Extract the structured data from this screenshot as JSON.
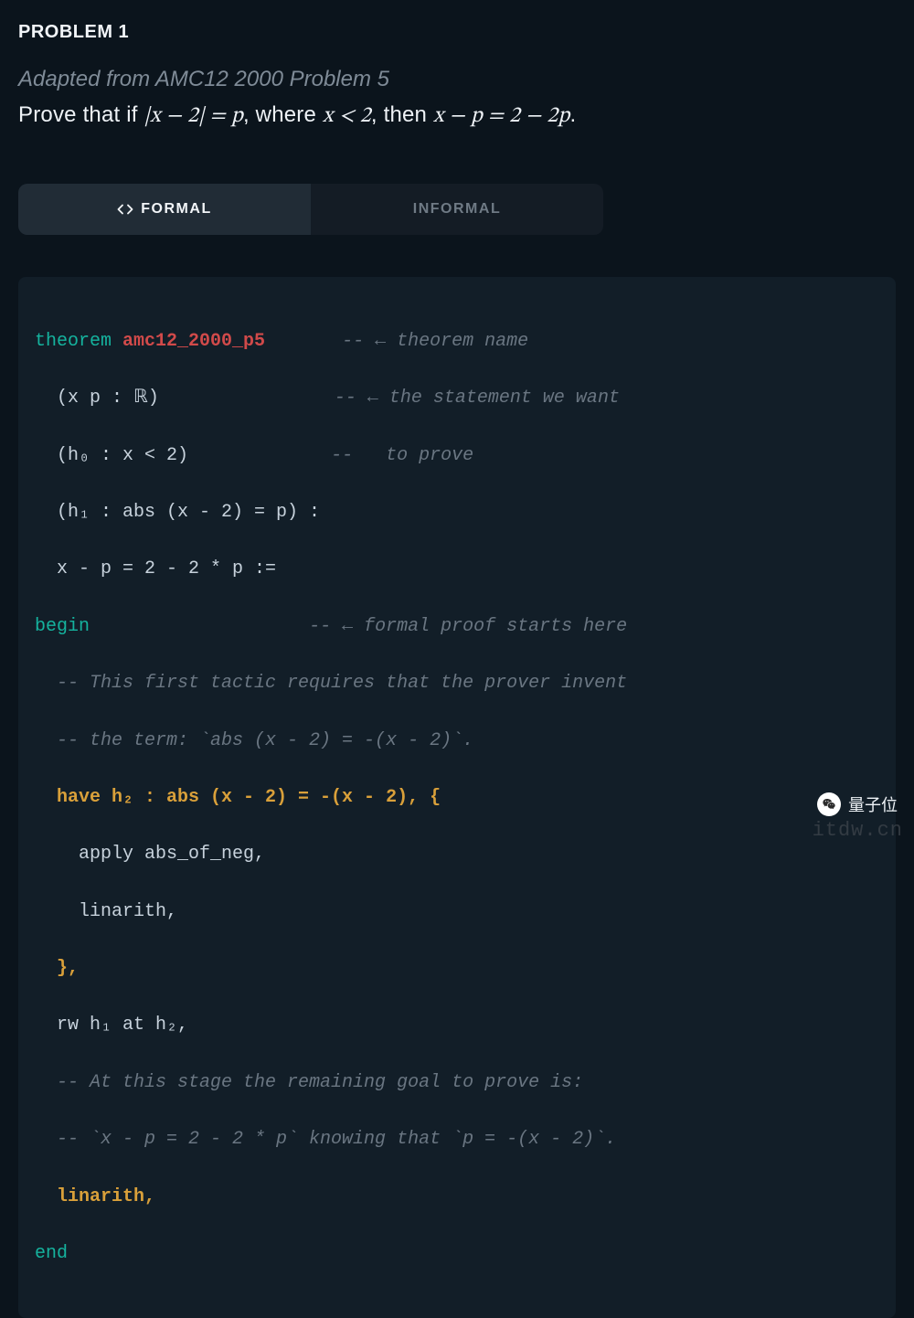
{
  "header": {
    "problem_label": "PROBLEM 1",
    "source": "Adapted from AMC12 2000 Problem 5",
    "statement_prefix": "Prove that if ",
    "statement_math1": "|x − 2| = p",
    "statement_mid1": ", where ",
    "statement_math2": "x < 2",
    "statement_mid2": ", then ",
    "statement_math3": "x − p = 2 − 2p",
    "statement_suffix": "."
  },
  "tabs": {
    "formal": "FORMAL",
    "informal": "INFORMAL",
    "icon_name": "code-icon"
  },
  "code": {
    "l1_kw": "theorem ",
    "l1_name": "amc12_2000_p5",
    "l1_pad": "       ",
    "l1_cmt": "-- ← theorem name",
    "l2_txt": "  (x p : ℝ)",
    "l2_pad": "                ",
    "l2_cmt": "-- ← the statement we want",
    "l3_txt": "  (h₀ : x < 2)",
    "l3_pad": "             ",
    "l3_cmt": "--   to prove",
    "l4_txt": "  (h₁ : abs (x - 2) = p) :",
    "l5_txt": "  x - p = 2 - 2 * p :=",
    "l6_kw": "begin",
    "l6_pad": "                    ",
    "l6_cmt": "-- ← formal proof starts here",
    "l7_cmt": "  -- This first tactic requires that the prover invent",
    "l8_cmt": "  -- the term: `abs (x - 2) = -(x - 2)`.",
    "l9_orange": "  have h₂ : abs (x - 2) = -(x - 2), {",
    "l10_txt": "    apply abs_of_neg,",
    "l11_txt": "    linarith,",
    "l12_orange": "  },",
    "l13_txt": "  rw h₁ at h₂,",
    "l14_cmt": "  -- At this stage the remaining goal to prove is:",
    "l15_cmt": "  -- `x - p = 2 - 2 * p` knowing that `p = -(x - 2)`.",
    "l16_orange": "  linarith,",
    "l17_kw": "end"
  },
  "watermark": {
    "text": "量子位",
    "domain": "itdw.cn"
  }
}
